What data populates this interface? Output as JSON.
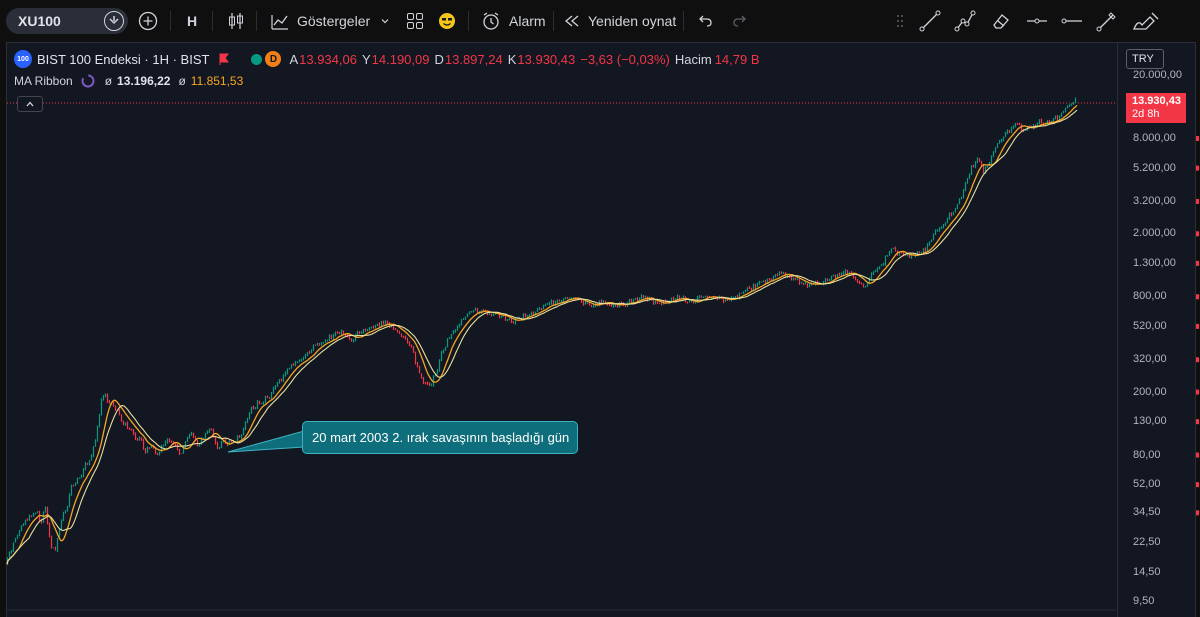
{
  "toolbar": {
    "symbol": "XU100",
    "interval": "H",
    "indicators_label": "Göstergeler",
    "alarm_label": "Alarm",
    "replay_label": "Yeniden oynat"
  },
  "legend": {
    "logo_text": "100",
    "title": "BIST 100 Endeksi · 1H · BIST",
    "d_badge": "D",
    "open_label": "A",
    "open_value": "13.934,06",
    "high_label": "Y",
    "high_value": "14.190,09",
    "low_label": "D",
    "low_value": "13.897,24",
    "close_label": "K",
    "close_value": "13.930,43",
    "change_value": "−3,63 (−0,03%)",
    "volume_label": "Hacim",
    "volume_value": "14,79 B"
  },
  "indicator": {
    "name": "MA Ribbon",
    "phi1": "ø",
    "value1": "13.196,22",
    "phi2": "ø",
    "value2": "11.851,53"
  },
  "price_scale": {
    "currency": "TRY",
    "last_price": "13.930,43",
    "countdown": "2d 8h",
    "ticks": [
      "20.000,00",
      "8.000,00",
      "5.200,00",
      "3.200,00",
      "2.000,00",
      "1.300,00",
      "800,00",
      "520,00",
      "320,00",
      "200,00",
      "130,00",
      "80,00",
      "52,00",
      "34,50",
      "22,50",
      "14,50",
      "9,50"
    ]
  },
  "annotation": {
    "text": "20 mart 2003 2. ırak savaşının başladığı gün"
  },
  "colors": {
    "background": "#131722",
    "up": "#089981",
    "down": "#f23645",
    "ma_fast": "#f5a623",
    "callout_fill": "#0e6e7c"
  },
  "chart_data": {
    "type": "line",
    "scale": "log",
    "ylim": [
      9.5,
      20000
    ],
    "series": [
      {
        "name": "BIST 100 Endeksi",
        "x_index": [
          0,
          8,
          14,
          20,
          26,
          32,
          36,
          40,
          44,
          46,
          50,
          54,
          58,
          62,
          66,
          72,
          76,
          80,
          86,
          90,
          96,
          100,
          106,
          112,
          118,
          124,
          130,
          136,
          140,
          146,
          152,
          158,
          164,
          170,
          176,
          180,
          186,
          192,
          196,
          200,
          206,
          212,
          218,
          224,
          228,
          232,
          236,
          240,
          244,
          248,
          252,
          256,
          260,
          264,
          270,
          276,
          282,
          288,
          296,
          304,
          310,
          318,
          326,
          334,
          340,
          346,
          352,
          358,
          364,
          370,
          376,
          382,
          388,
          394,
          400,
          406,
          410,
          414,
          420,
          426,
          432,
          436,
          440,
          444,
          448,
          452,
          456,
          460,
          466,
          472,
          478,
          484,
          490,
          496,
          502,
          508,
          514,
          520,
          526,
          532,
          538,
          544,
          550,
          556,
          562,
          568,
          574,
          580,
          586,
          592,
          598,
          604,
          610,
          614,
          620,
          626,
          632,
          638,
          644,
          650,
          656,
          662,
          668,
          674,
          680,
          686,
          692,
          698,
          704,
          710,
          716,
          722,
          728,
          734,
          740,
          746,
          752,
          758,
          764,
          770,
          776,
          782,
          788,
          794,
          800,
          806,
          812,
          818,
          824,
          830,
          836,
          842,
          848,
          854,
          860,
          866,
          872,
          878,
          882,
          886,
          890,
          896,
          902,
          908,
          914,
          920,
          926,
          932,
          938,
          944,
          950,
          954,
          958,
          962,
          966,
          970,
          974,
          978,
          982,
          986,
          990,
          994,
          998,
          1002,
          1006,
          1010,
          1014,
          1018,
          1022,
          1028,
          1034,
          1040,
          1046,
          1052,
          1058,
          1064,
          1070,
          1076,
          1082,
          1088,
          1094,
          1100,
          1106,
          1110,
          1114,
          1116
        ],
        "values": [
          17,
          22,
          27,
          31,
          33,
          35,
          30,
          38,
          24,
          21,
          20,
          28,
          35,
          38,
          50,
          55,
          60,
          70,
          80,
          100,
          180,
          190,
          170,
          150,
          130,
          120,
          105,
          100,
          85,
          90,
          80,
          95,
          100,
          90,
          80,
          100,
          110,
          95,
          100,
          110,
          115,
          90,
          100,
          95,
          98,
          103,
          110,
          130,
          150,
          160,
          175,
          170,
          180,
          190,
          220,
          240,
          280,
          300,
          320,
          360,
          400,
          420,
          450,
          480,
          460,
          430,
          470,
          480,
          500,
          520,
          550,
          540,
          520,
          480,
          430,
          380,
          320,
          260,
          230,
          230,
          280,
          350,
          400,
          450,
          480,
          520,
          560,
          600,
          640,
          660,
          650,
          620,
          630,
          600,
          580,
          560,
          600,
          620,
          640,
          660,
          700,
          720,
          740,
          760,
          800,
          780,
          760,
          720,
          700,
          740,
          760,
          720,
          700,
          720,
          740,
          760,
          780,
          800,
          770,
          740,
          720,
          760,
          780,
          800,
          760,
          740,
          780,
          800,
          820,
          800,
          780,
          760,
          800,
          820,
          880,
          920,
          960,
          1000,
          1050,
          1100,
          1150,
          1100,
          1050,
          1000,
          980,
          960,
          980,
          1000,
          1050,
          1100,
          1120,
          1150,
          1080,
          1000,
          950,
          1100,
          1200,
          1350,
          1500,
          1600,
          1550,
          1500,
          1450,
          1500,
          1550,
          1600,
          1900,
          2100,
          2300,
          2600,
          2900,
          3300,
          3800,
          4500,
          5200,
          5600,
          5900,
          5000,
          5500,
          6200,
          7000,
          7600,
          8200,
          8800,
          9500,
          10000,
          9700,
          9200,
          9500,
          9800,
          10200,
          10100,
          10300,
          11000,
          12000,
          13000,
          13930
        ]
      }
    ]
  }
}
